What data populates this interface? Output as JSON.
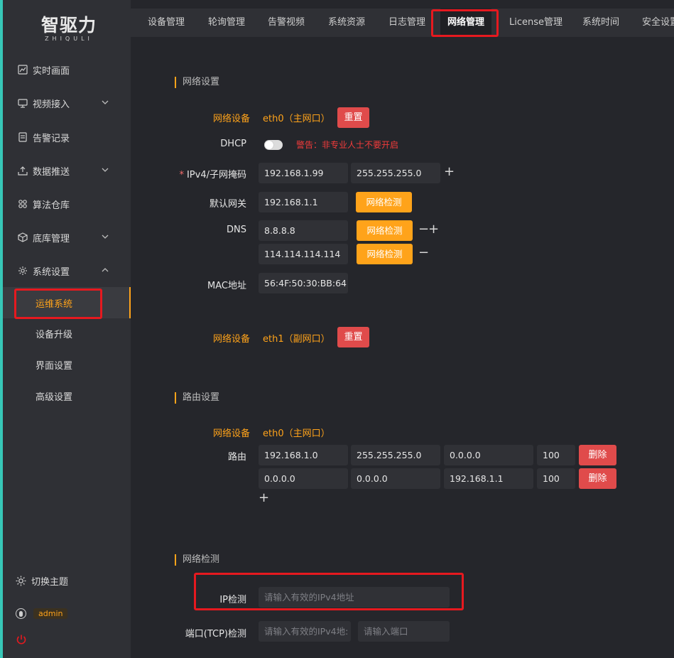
{
  "brand": {
    "name_cn": "智驱力",
    "name_en": "ZHIQULI"
  },
  "sidebar": {
    "items": [
      {
        "label": "实时画面",
        "icon": "chart-icon"
      },
      {
        "label": "视频接入",
        "icon": "monitor-icon",
        "expandable": true
      },
      {
        "label": "告警记录",
        "icon": "document-icon"
      },
      {
        "label": "数据推送",
        "icon": "upload-icon",
        "expandable": true
      },
      {
        "label": "算法仓库",
        "icon": "algorithm-icon"
      },
      {
        "label": "底库管理",
        "icon": "cube-icon",
        "expandable": true
      },
      {
        "label": "系统设置",
        "icon": "gear-icon",
        "expandable": true,
        "expanded": true
      }
    ],
    "sub_items": [
      {
        "label": "运维系统",
        "active": true
      },
      {
        "label": "设备升级"
      },
      {
        "label": "界面设置"
      },
      {
        "label": "高级设置"
      }
    ],
    "theme_label": "切换主题",
    "user": "admin"
  },
  "tabs": [
    "设备管理",
    "轮询管理",
    "告警视频",
    "系统资源",
    "日志管理",
    "网络管理",
    "License管理",
    "系统时间",
    "安全设置"
  ],
  "active_tab": "网络管理",
  "network": {
    "title": "网络设置",
    "device_label": "网络设备",
    "eth0": "eth0（主网口）",
    "reset": "重置",
    "dhcp_label": "DHCP",
    "dhcp_on": false,
    "dhcp_warning": "警告：非专业人士不要开启",
    "ipv4_label": "IPv4/子网掩码",
    "ip": "192.168.1.99",
    "mask": "255.255.255.0",
    "gateway_label": "默认网关",
    "gateway": "192.168.1.1",
    "detect": "网络检测",
    "dns_label": "DNS",
    "dns1": "8.8.8.8",
    "dns2": "114.114.114.114",
    "mac_label": "MAC地址",
    "mac": "56:4F:50:30:BB:64",
    "eth1": "eth1（副网口）"
  },
  "route": {
    "title": "路由设置",
    "device_label": "网络设备",
    "device": "eth0（主网口）",
    "route_label": "路由",
    "rows": [
      [
        "192.168.1.0",
        "255.255.255.0",
        "0.0.0.0",
        "100"
      ],
      [
        "0.0.0.0",
        "0.0.0.0",
        "192.168.1.1",
        "100"
      ]
    ],
    "delete": "删除"
  },
  "check": {
    "title": "网络检测",
    "ip_label": "IP检测",
    "ip_placeholder": "请输入有效的IPv4地址",
    "tcp_label": "端口(TCP)检测",
    "tcp_ip_placeholder": "请输入有效的IPv4地:",
    "port_placeholder": "请输入端口"
  },
  "colors": {
    "accent": "#ffa31a",
    "danger": "#e04b4b",
    "highlight": "#e6191f",
    "bg": "#25262b"
  }
}
